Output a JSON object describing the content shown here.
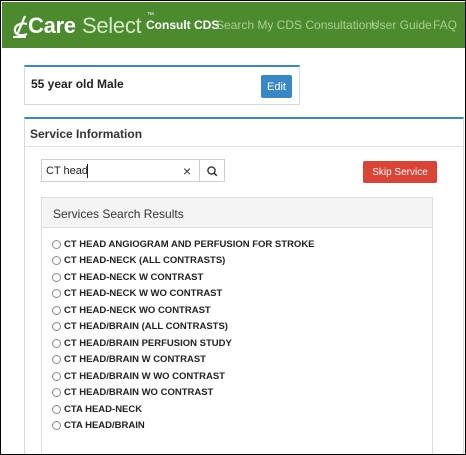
{
  "navbar": {
    "logo": {
      "care": "Care",
      "select": "Select",
      "tm": "™"
    },
    "items": [
      {
        "label": "Consult CDS",
        "active": true
      },
      {
        "label": "Search My CDS Consultations",
        "active": false
      },
      {
        "label": "User Guide",
        "active": false
      },
      {
        "label": "FAQ",
        "active": false
      }
    ]
  },
  "patient": {
    "summary": "55 year old Male",
    "edit_label": "Edit"
  },
  "service": {
    "heading": "Service Information",
    "search": {
      "value": "CT head",
      "clear_symbol": "×"
    },
    "skip_label": "Skip Service",
    "results_heading": "Services Search Results",
    "results": [
      {
        "label": "CT HEAD ANGIOGRAM AND PERFUSION FOR STROKE"
      },
      {
        "label": "CT HEAD-NECK (ALL CONTRASTS)"
      },
      {
        "label": "CT HEAD-NECK W CONTRAST"
      },
      {
        "label": "CT HEAD-NECK W WO CONTRAST"
      },
      {
        "label": "CT HEAD-NECK WO CONTRAST"
      },
      {
        "label": "CT HEAD/BRAIN (ALL CONTRASTS)"
      },
      {
        "label": "CT HEAD/BRAIN PERFUSION STUDY"
      },
      {
        "label": "CT HEAD/BRAIN W CONTRAST"
      },
      {
        "label": "CT HEAD/BRAIN W WO CONTRAST"
      },
      {
        "label": "CT HEAD/BRAIN WO CONTRAST"
      },
      {
        "label": "CTA HEAD-NECK"
      },
      {
        "label": "CTA HEAD/BRAIN"
      }
    ]
  },
  "colors": {
    "navbar_bg": "#4c8a2e",
    "primary_blue": "#3a87c8",
    "danger_red": "#d94436"
  },
  "icons": {
    "search": "search-icon",
    "clear": "clear-icon",
    "logo": "caresselect-logo-mark"
  }
}
